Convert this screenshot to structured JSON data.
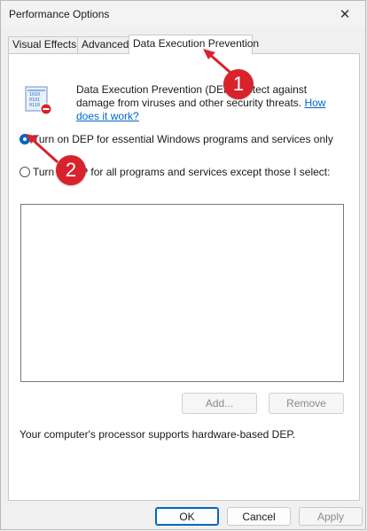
{
  "window": {
    "title": "Performance Options",
    "close_glyph": "✕"
  },
  "tabs": [
    {
      "label": "Visual Effects"
    },
    {
      "label": "Advanced"
    },
    {
      "label": "Data Execution Prevention"
    }
  ],
  "dep": {
    "description_part1": "Data Execution Prevention (DEP) ",
    "description_part2": "protect against damage from viruses and other security threats. ",
    "link": "How does it work?",
    "option_essential": "Turn on DEP for essential Windows programs and services only",
    "option_all_prefix": "Turn",
    "option_all_suffix": "P for all programs and services except those I select:",
    "add_button": "Add...",
    "remove_button": "Remove",
    "status": "Your computer's processor supports hardware-based DEP."
  },
  "footer": {
    "ok": "OK",
    "cancel": "Cancel",
    "apply": "Apply"
  },
  "annotations": [
    {
      "number": "1"
    },
    {
      "number": "2"
    }
  ],
  "colors": {
    "accent": "#0067c0",
    "badge": "#d9232c",
    "link": "#0066cc"
  },
  "icons": {
    "dep": "dep-shield-icon",
    "close": "close-icon"
  }
}
